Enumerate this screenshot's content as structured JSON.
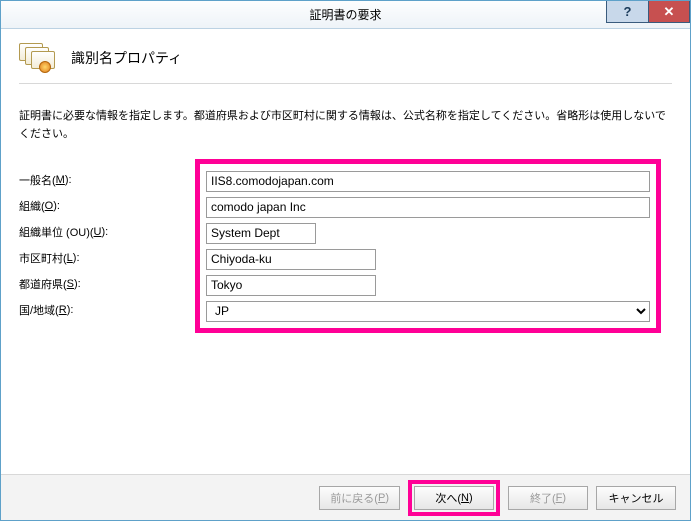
{
  "window": {
    "title": "証明書の要求"
  },
  "header": {
    "title": "識別名プロパティ"
  },
  "description": "証明書に必要な情報を指定します。都道府県および市区町村に関する情報は、公式名称を指定してください。省略形は使用しないでください。",
  "labels": {
    "common_name": "一般名(",
    "common_name_u": "M",
    "common_name_after": "):",
    "org": "組織(",
    "org_u": "O",
    "org_after": "):",
    "ou": "組織単位 (OU)(",
    "ou_u": "U",
    "ou_after": "):",
    "city": "市区町村(",
    "city_u": "L",
    "city_after": "):",
    "state": "都道府県(",
    "state_u": "S",
    "state_after": "):",
    "country": "国/地域(",
    "country_u": "R",
    "country_after": "):"
  },
  "fields": {
    "common_name": "IIS8.comodojapan.com",
    "organization": "comodo japan Inc",
    "organizational_unit": "System Dept",
    "city": "Chiyoda-ku",
    "state": "Tokyo",
    "country": "JP"
  },
  "buttons": {
    "back": "前に戻る(",
    "back_u": "P",
    "back_after": ")",
    "next": "次へ(",
    "next_u": "N",
    "next_after": ")",
    "finish": "終了(",
    "finish_u": "F",
    "finish_after": ")",
    "cancel": "キャンセル"
  }
}
